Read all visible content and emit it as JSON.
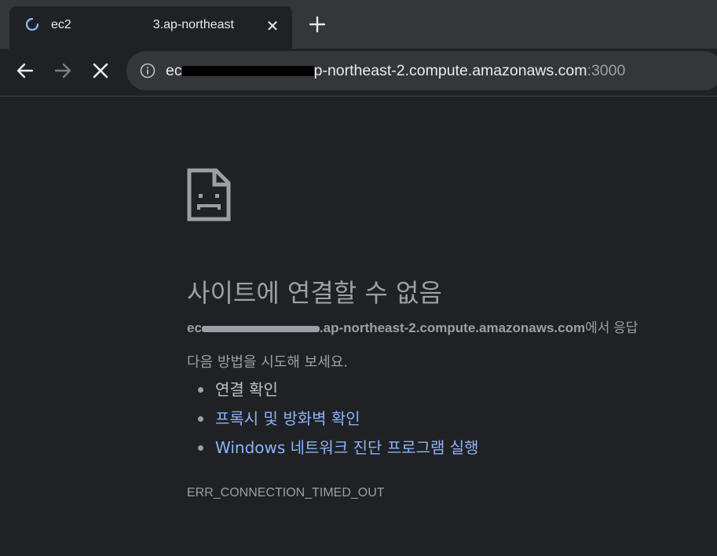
{
  "tab": {
    "title_start": "ec2",
    "title_end": "3.ap-northeast",
    "close_label": "✕"
  },
  "new_tab_label": "+",
  "omnibox": {
    "url_prefix": "ec",
    "url_main": "p-northeast-2.compute.amazonaws.com",
    "url_port": ":3000"
  },
  "error_page": {
    "heading": "사이트에 연결할 수 없음",
    "host_prefix": "ec",
    "host_main": ".ap-northeast-2.compute.amazonaws.com",
    "host_suffix": "에서 응답",
    "try_text": "다음 방법을 시도해 보세요.",
    "suggestions": [
      "연결 확인",
      "프록시 및 방화벽 확인",
      "Windows 네트워크 진단 프로그램 실행"
    ],
    "error_code": "ERR_CONNECTION_TIMED_OUT"
  },
  "colors": {
    "background": "#202124",
    "tabstrip": "#35363a",
    "link": "#8ab4f8",
    "text_muted": "#9aa0a6"
  }
}
